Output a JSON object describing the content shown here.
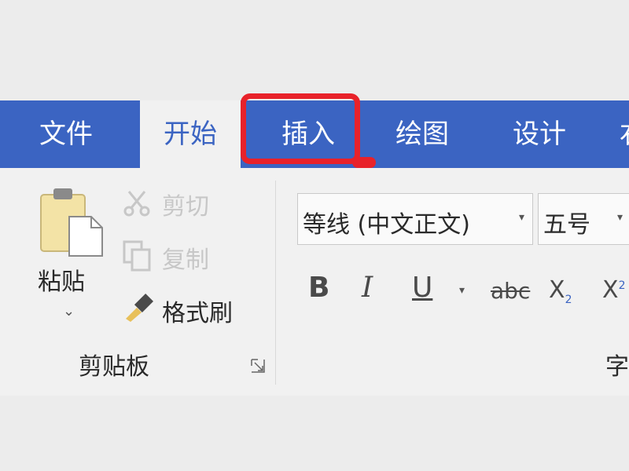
{
  "tabs": {
    "file": "文件",
    "home": "开始",
    "insert": "插入",
    "draw": "绘图",
    "design": "设计",
    "more": "右"
  },
  "clipboard": {
    "paste_label": "粘贴",
    "paste_arrow": "⌄",
    "cut_label": "剪切",
    "copy_label": "复制",
    "format_painter_label": "格式刷",
    "group_title": "剪贴板"
  },
  "font": {
    "font_name": "等线 (中文正文)",
    "font_size": "五号",
    "dropdown_arrow": "▾",
    "bold": "B",
    "italic": "I",
    "underline": "U",
    "strikethrough": "abc",
    "subscript_base": "X",
    "subscript_mark": "2",
    "superscript_base": "X",
    "superscript_mark": "2",
    "group_title": "字"
  },
  "colors": {
    "tab_bar": "#3b64c2",
    "highlight": "#e8222a",
    "ribbon": "#f1f1f1"
  }
}
